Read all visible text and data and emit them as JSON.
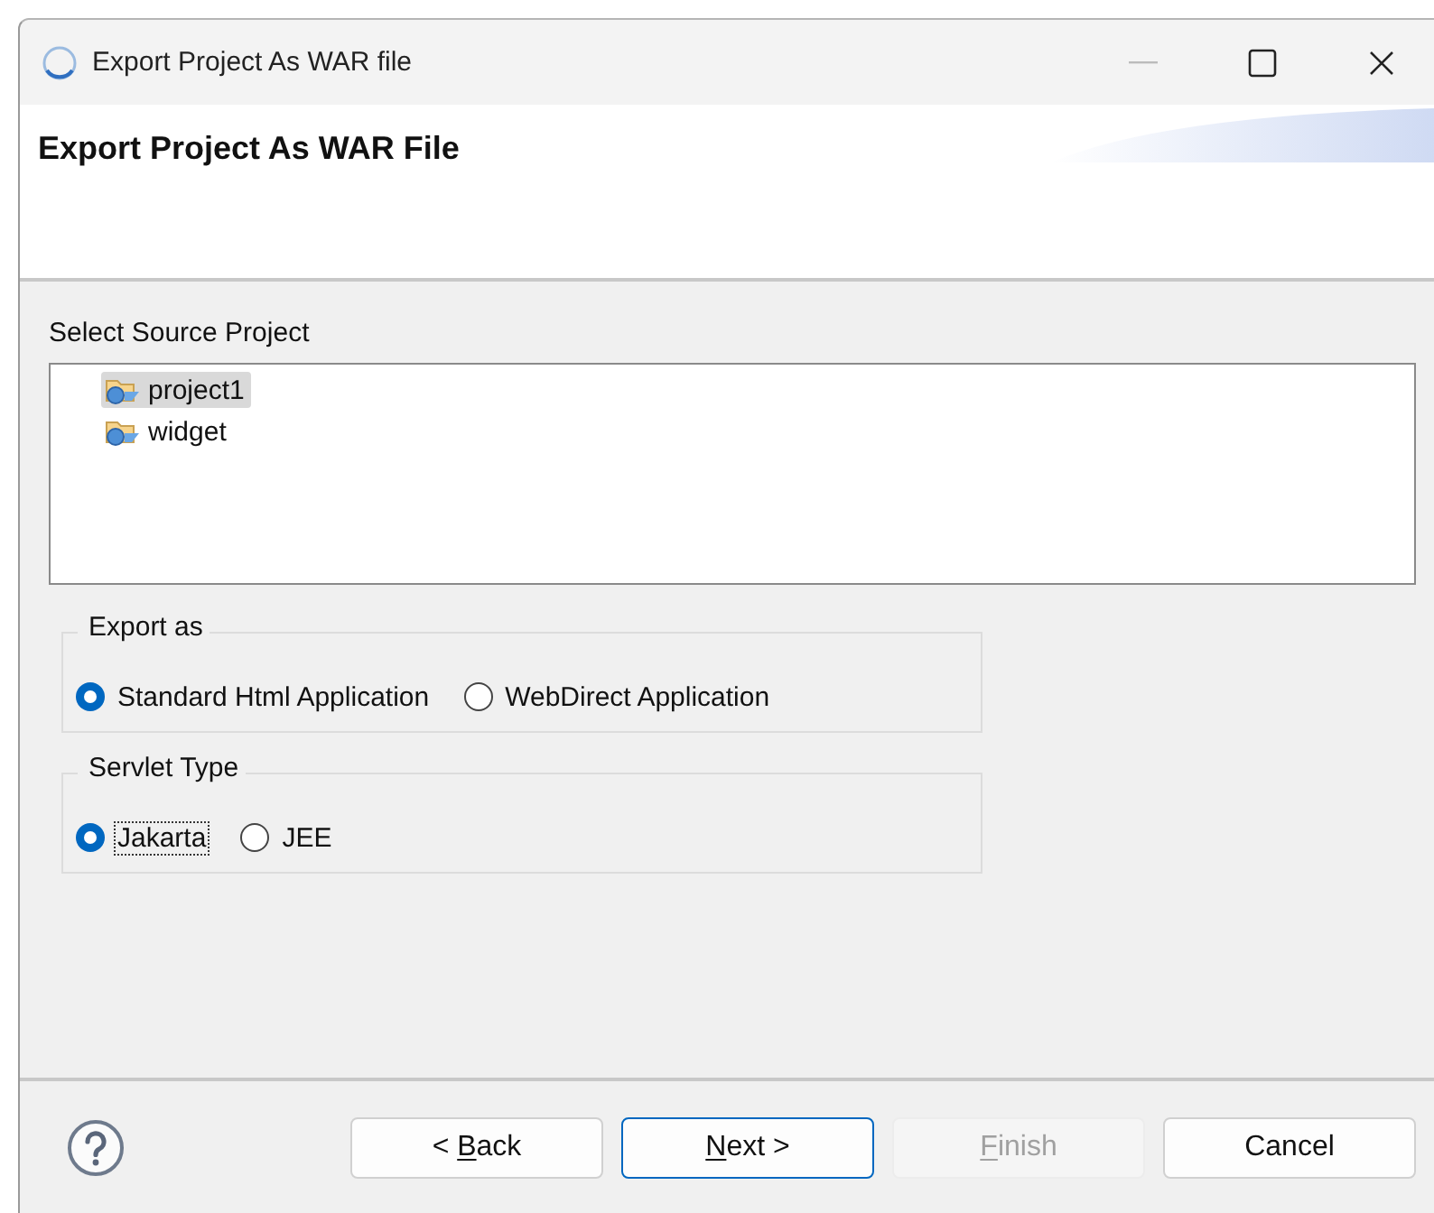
{
  "window": {
    "title": "Export Project As WAR file"
  },
  "header": {
    "title": "Export Project As WAR File"
  },
  "source": {
    "label": "Select Source Project",
    "projects": [
      {
        "name": "project1",
        "selected": true
      },
      {
        "name": "widget",
        "selected": false
      }
    ]
  },
  "groups": [
    {
      "title": "Export as",
      "options": [
        {
          "label": "Standard Html Application",
          "selected": true,
          "focused": false
        },
        {
          "label": "WebDirect Application",
          "selected": false,
          "focused": false
        }
      ]
    },
    {
      "title": "Servlet Type",
      "options": [
        {
          "label": "Jakarta",
          "selected": true,
          "focused": true
        },
        {
          "label": "JEE",
          "selected": false,
          "focused": false
        }
      ]
    }
  ],
  "buttons": [
    {
      "before": "< ",
      "key": "B",
      "after": "ack",
      "disabled": false,
      "default": false
    },
    {
      "key": "N",
      "after": "ext >",
      "disabled": false,
      "default": true
    },
    {
      "key": "F",
      "after": "inish",
      "disabled": true,
      "default": false
    },
    {
      "before": "Cancel",
      "disabled": false,
      "default": false
    }
  ]
}
